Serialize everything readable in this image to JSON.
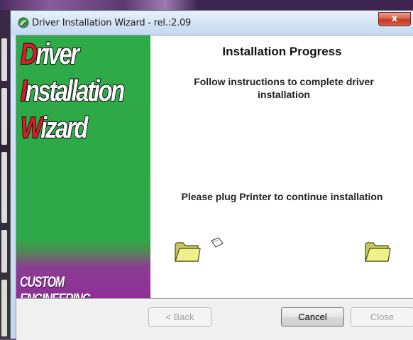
{
  "window": {
    "title": "Driver Installation Wizard - rel.:2.09",
    "close_label": "x"
  },
  "banner": {
    "words": [
      {
        "cap": "D",
        "rest": "river"
      },
      {
        "cap": "I",
        "rest": "nstallation"
      },
      {
        "cap": "W",
        "rest": "izard"
      }
    ],
    "footer": "CUSTOM ENGINEERING",
    "colors": {
      "green": "#2faa48",
      "purple": "#8e2f96",
      "red": "#e01a2a"
    }
  },
  "content": {
    "heading": "Installation Progress",
    "instructions": "Follow instructions to complete driver installation",
    "plug_message": "Please plug Printer to continue installation",
    "icons": [
      "source-folder-icon",
      "flying-paper-icon",
      "destination-folder-icon"
    ]
  },
  "buttons": {
    "back": "< Back",
    "cancel": "Cancel",
    "close": "Close"
  }
}
